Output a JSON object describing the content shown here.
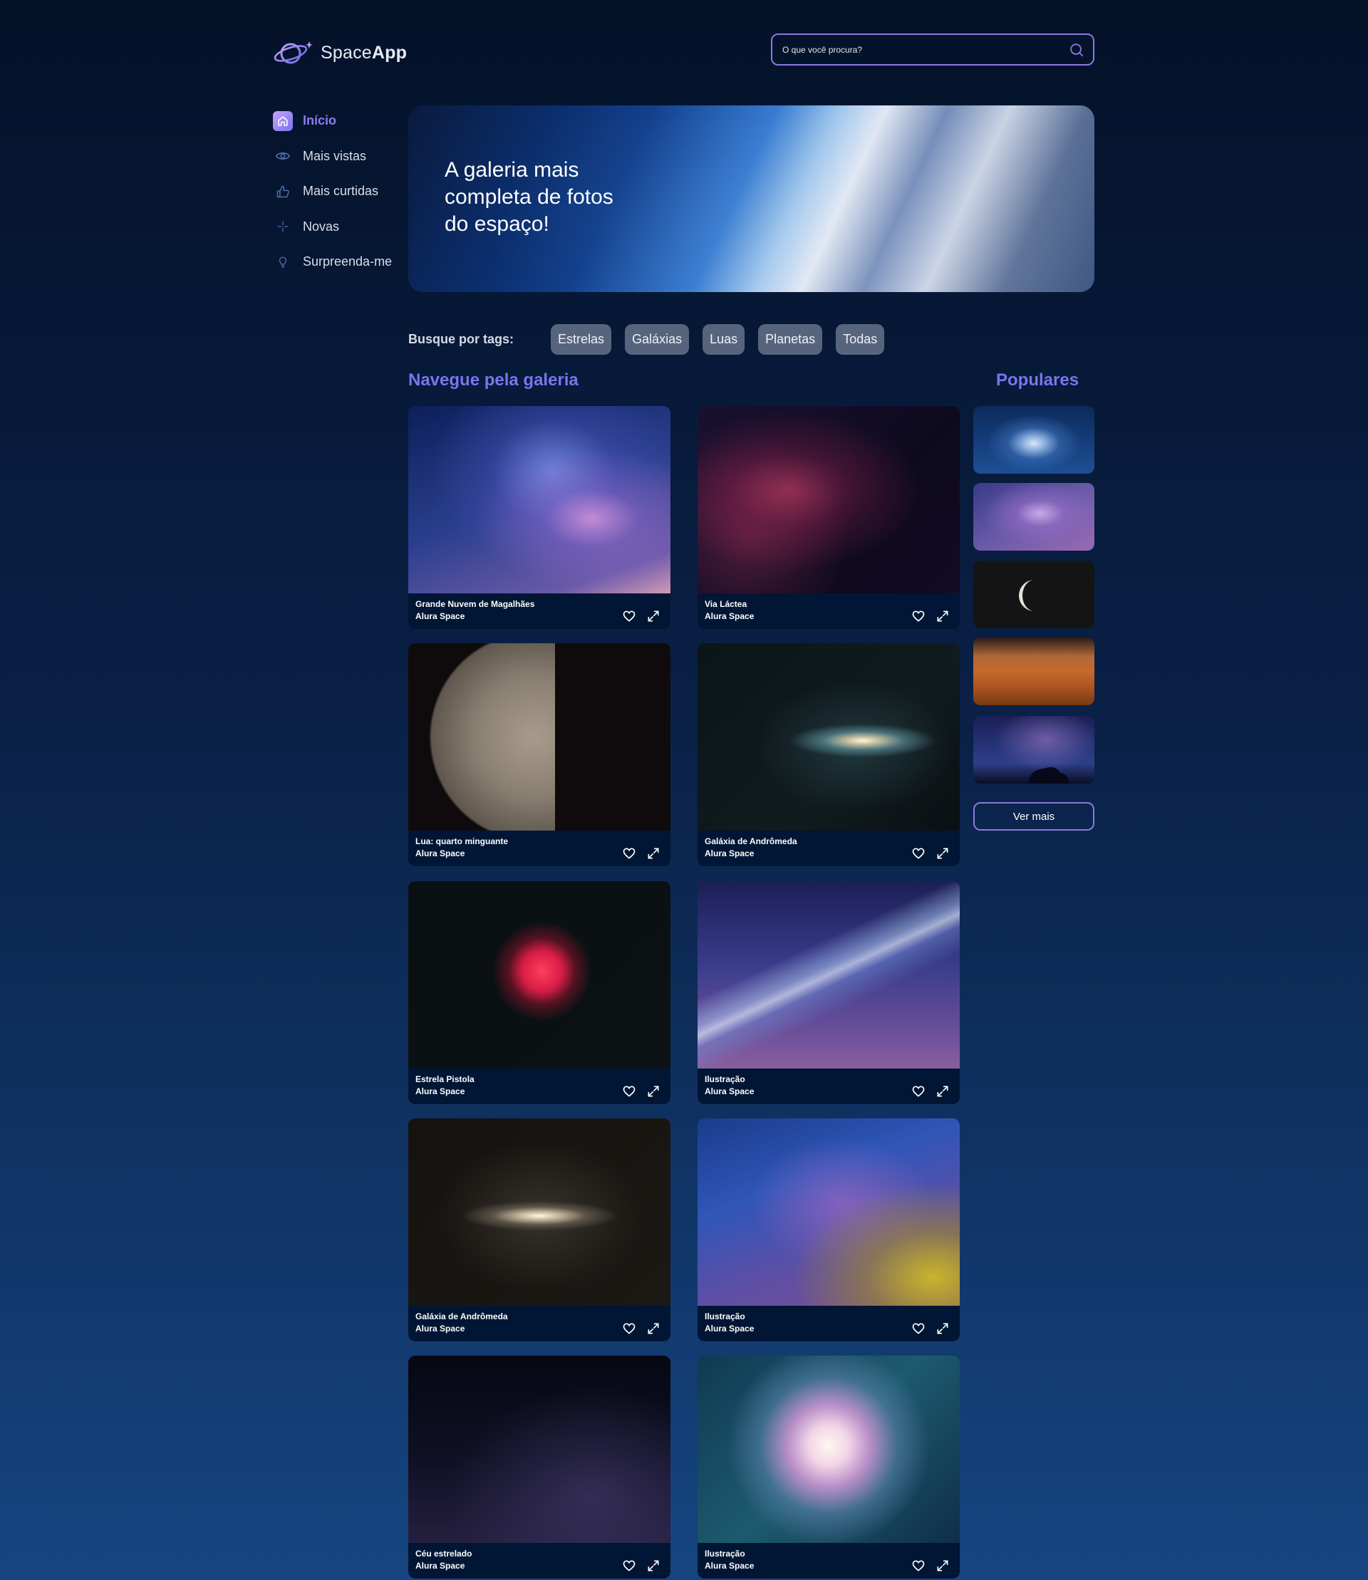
{
  "logo": {
    "part1": "Space",
    "part2": "App"
  },
  "search": {
    "placeholder": "O que você procura?"
  },
  "nav": [
    {
      "label": "Início",
      "icon": "home-icon",
      "active": true
    },
    {
      "label": "Mais vistas",
      "icon": "eye-icon"
    },
    {
      "label": "Mais curtidas",
      "icon": "thumbs-up-icon"
    },
    {
      "label": "Novas",
      "icon": "sparkle-icon"
    },
    {
      "label": "Surpreenda-me",
      "icon": "lightbulb-icon"
    }
  ],
  "banner": {
    "title": "A galeria mais completa de fotos do espaço!"
  },
  "tags": {
    "label": "Busque por tags:",
    "items": [
      "Estrelas",
      "Galáxias",
      "Luas",
      "Planetas",
      "Todas"
    ]
  },
  "gallery": {
    "title": "Navegue pela galeria",
    "items": [
      {
        "title": "Grande Nuvem de Magalhães",
        "author": "Alura Space"
      },
      {
        "title": "Via Láctea",
        "author": "Alura Space"
      },
      {
        "title": "Lua: quarto minguante",
        "author": "Alura Space"
      },
      {
        "title": "Galáxia de Andrômeda",
        "author": "Alura Space"
      },
      {
        "title": "Estrela Pistola",
        "author": "Alura Space"
      },
      {
        "title": "Ilustração",
        "author": "Alura Space"
      },
      {
        "title": "Galáxia de Andrômeda",
        "author": "Alura Space"
      },
      {
        "title": "Ilustração",
        "author": "Alura Space"
      },
      {
        "title": "Céu estrelado",
        "author": "Alura Space"
      },
      {
        "title": "Ilustração",
        "author": "Alura Space"
      }
    ]
  },
  "popular": {
    "title": "Populares",
    "see_more": "Ver mais"
  },
  "colors": {
    "accent": "#7b74ef",
    "border": "#8c79e0",
    "card_footer": "#001634",
    "tag_bg": "#56657d"
  }
}
